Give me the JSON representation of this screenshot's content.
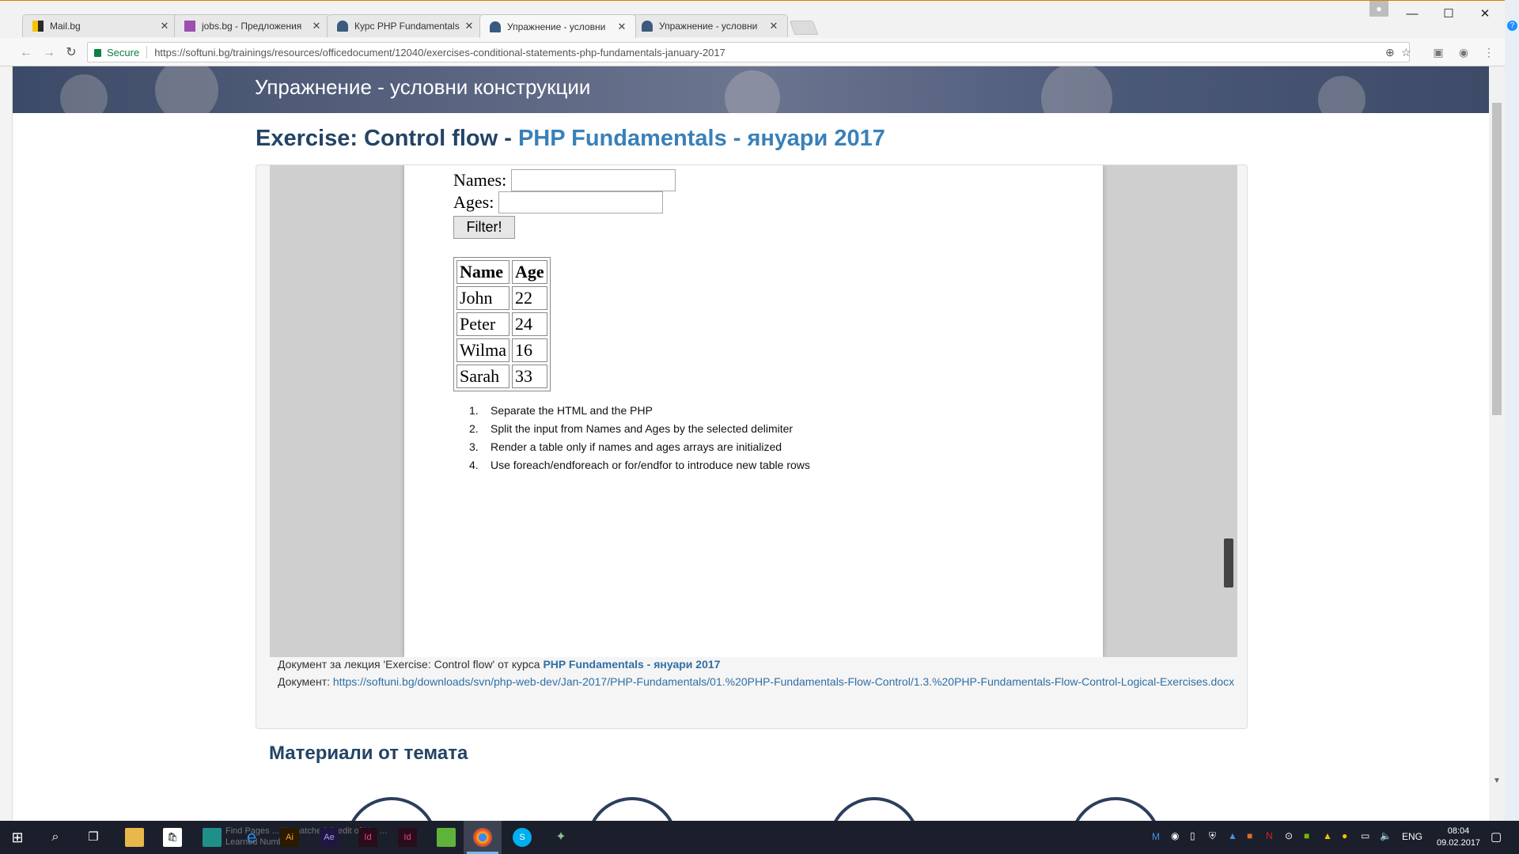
{
  "browser": {
    "tabs": [
      {
        "title": "Mail.bg",
        "active": false
      },
      {
        "title": "jobs.bg - Предложения",
        "active": false
      },
      {
        "title": "Курс PHP Fundamentals",
        "active": false
      },
      {
        "title": "Упражнение - условни",
        "active": true
      },
      {
        "title": "Упражнение - условни",
        "active": false
      }
    ],
    "secure_label": "Secure",
    "url": "https://softuni.bg/trainings/resources/officedocument/12040/exercises-conditional-statements-php-fundamentals-january-2017"
  },
  "page": {
    "hero_title": "Упражнение - условни конструкции",
    "heading_prefix": "Exercise: Control flow - ",
    "heading_link": "PHP Fundamentals - януари 2017",
    "form": {
      "names_label": "Names:",
      "ages_label": "Ages:",
      "filter_button": "Filter!"
    },
    "table": {
      "headers": [
        "Name",
        "Age"
      ],
      "rows": [
        [
          "John",
          "22"
        ],
        [
          "Peter",
          "24"
        ],
        [
          "Wilma",
          "16"
        ],
        [
          "Sarah",
          "33"
        ]
      ]
    },
    "steps": [
      {
        "n": "1.",
        "text": "Separate the HTML and the PHP"
      },
      {
        "n": "2.",
        "text": "Split the input from Names and Ages by the selected delimiter"
      },
      {
        "n": "3.",
        "text": "Render a table only if names and ages arrays are initialized"
      },
      {
        "n": "4.",
        "text": "Use foreach/endforeach or for/endfor to introduce new table rows"
      }
    ],
    "meta": {
      "lecture_prefix": "Документ за лекция 'Exercise: Control flow' от курса ",
      "course_link": "PHP Fundamentals - януари 2017",
      "doc_prefix": "Документ: ",
      "doc_url": "https://softuni.bg/downloads/svn/php-web-dev/Jan-2017/PHP-Fundamentals/01.%20PHP-Fundamentals-Flow-Control/1.3.%20PHP-Fundamentals-Flow-Control-Logical-Exercises.docx"
    },
    "materials_heading": "Материали от темата"
  },
  "taskbar": {
    "lang": "ENG",
    "time": "08:04",
    "date": "09.02.2017"
  }
}
